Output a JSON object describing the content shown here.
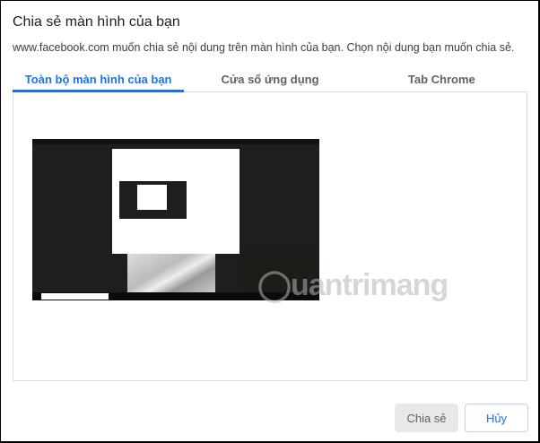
{
  "dialog": {
    "title": "Chia sẻ màn hình của bạn",
    "description": "www.facebook.com muốn chia sẻ nội dung trên màn hình của bạn. Chọn nội dung bạn muốn chia sẻ.",
    "tabs": [
      {
        "label": "Toàn bộ màn hình của bạn",
        "active": true
      },
      {
        "label": "Cửa sổ ứng dụng",
        "active": false
      },
      {
        "label": "Tab Chrome",
        "active": false
      }
    ],
    "share_label": "Chia sẻ",
    "cancel_label": "Hủy"
  },
  "watermark": "uantrimang",
  "colors": {
    "accent": "#1a73e8",
    "disabled_bg": "#e8e8e8"
  }
}
